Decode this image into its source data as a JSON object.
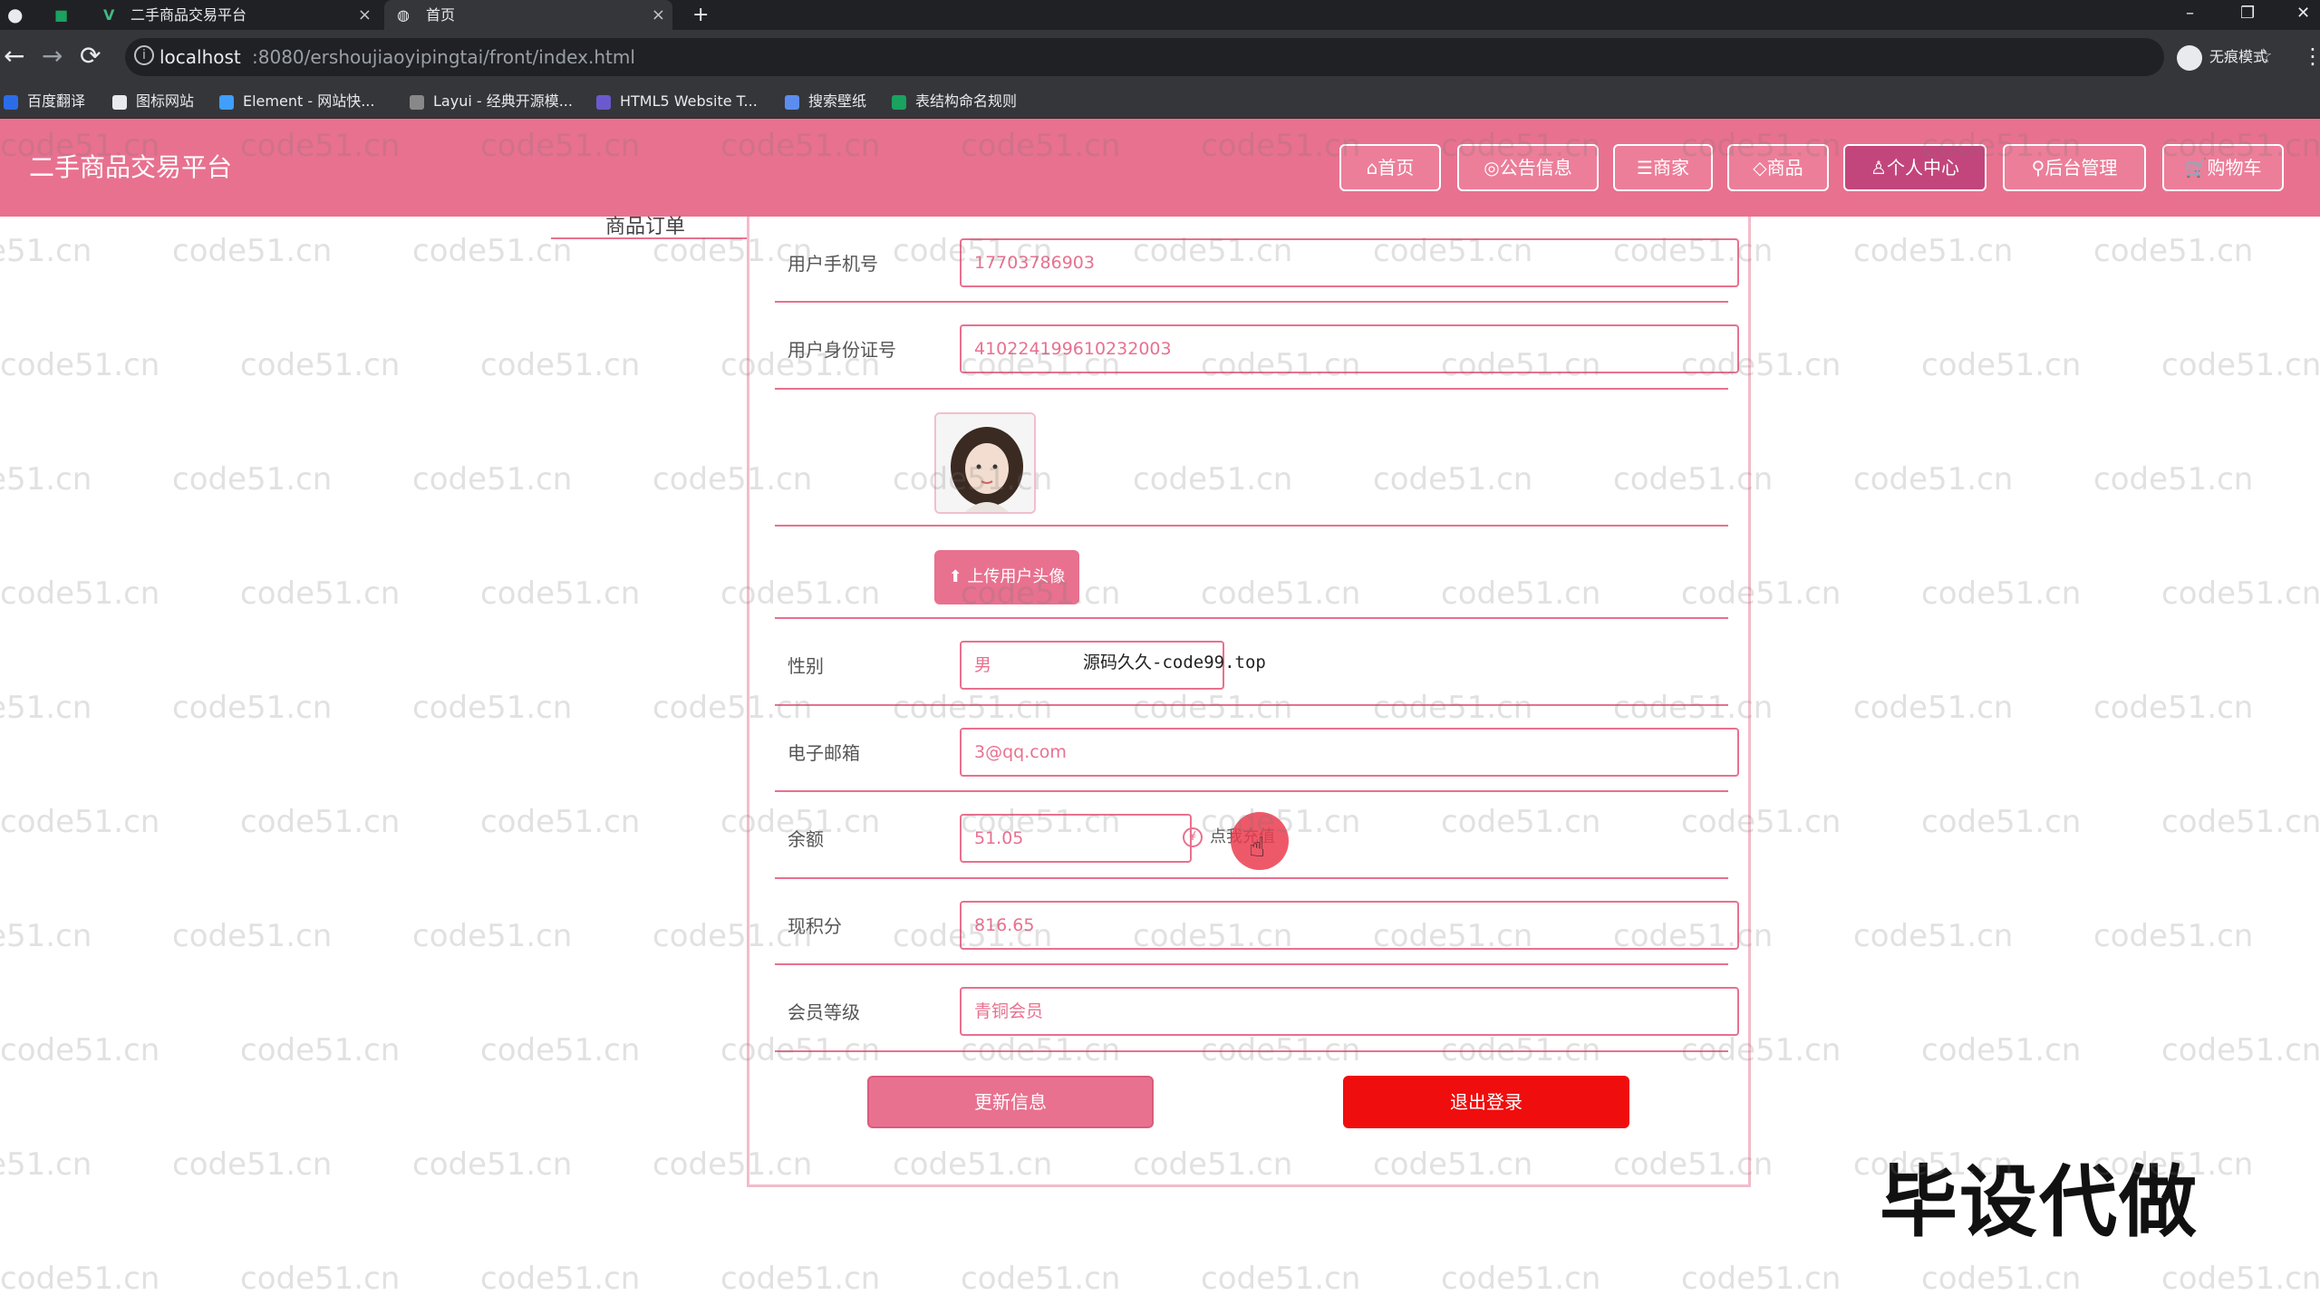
{
  "browser": {
    "tabs": [
      {
        "title": "二手商品交易平台",
        "close": "×"
      },
      {
        "title": "首页",
        "close": "×"
      }
    ],
    "new_tab": "+",
    "window_controls": [
      "–",
      "❐",
      "✕"
    ],
    "nav": {
      "back": "←",
      "forward": "→",
      "reload": "⟳"
    },
    "url_host": "localhost",
    "url_path": ":8080/ershoujiaoyipingtai/front/index.html",
    "star": "☆",
    "incognito_label": "无痕模式",
    "menu": "⋮",
    "bookmarks": [
      {
        "label": "百度翻译",
        "color": "#2b6de8"
      },
      {
        "label": "图标网站",
        "color": "#ffffff"
      },
      {
        "label": "Element - 网站快...",
        "color": "#409eff"
      },
      {
        "label": "Layui - 经典开源模...",
        "color": "#cccccc"
      },
      {
        "label": "HTML5 Website T...",
        "color": "#6a5acd"
      },
      {
        "label": "搜索壁纸",
        "color": "#5b8def"
      },
      {
        "label": "表结构命名规则",
        "color": "#1aa260"
      }
    ]
  },
  "header": {
    "site_title": "二手商品交易平台",
    "nav": [
      {
        "label": "⌂首页",
        "active": false
      },
      {
        "label": "◎公告信息",
        "active": false
      },
      {
        "label": "☰商家",
        "active": false
      },
      {
        "label": "◇商品",
        "active": false
      },
      {
        "label": "♙个人中心",
        "active": true
      },
      {
        "label": "⚲后台管理",
        "active": false
      },
      {
        "label": "🛒购物车",
        "active": false
      }
    ]
  },
  "sidebar": {
    "partial_link": "商品订单"
  },
  "profile": {
    "phone_label": "用户手机号",
    "phone_value": "17703786903",
    "idcard_label": "用户身份证号",
    "idcard_value": "410224199610232003",
    "upload_label": "上传用户头像",
    "gender_label": "性别",
    "gender_value": "男",
    "email_label": "电子邮箱",
    "email_value": "3@qq.com",
    "balance_label": "余额",
    "balance_value": "51.05",
    "recharge_icon": "¥",
    "recharge_label": "点我充值",
    "points_label": "现积分",
    "points_value": "816.65",
    "member_label": "会员等级",
    "member_value": "青铜会员",
    "update_button": "更新信息",
    "logout_button": "退出登录"
  },
  "overlay_note": "源码久久-code99.top",
  "promo_text": "毕设代做",
  "watermark_text": "code51.cn",
  "colors": {
    "brand": "#e8718f",
    "active_nav": "#c2467c",
    "danger": "#f00d0d"
  }
}
